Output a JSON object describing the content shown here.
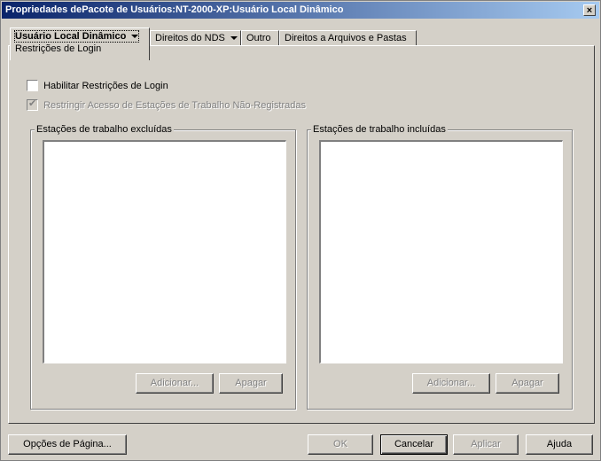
{
  "window": {
    "title": "Propriedades dePacote de Usuários:NT-2000-XP:Usuário Local Dinâmico",
    "close_glyph": "×"
  },
  "tabs": {
    "active": {
      "label": "Usuário Local Dinâmico",
      "sublabel": "Restrições de Login"
    },
    "nds": {
      "label": "Direitos do NDS"
    },
    "outro": {
      "label": "Outro"
    },
    "files": {
      "label": "Direitos a Arquivos e Pastas"
    }
  },
  "options": {
    "enable_login_restrictions": {
      "label": "Habilitar Restrições de Login",
      "checked": false
    },
    "restrict_unregistered": {
      "label": "Restringir Acesso de Estações de Trabalho Não-Registradas",
      "checked": true,
      "enabled": false
    }
  },
  "excluded_group": {
    "title": "Estações de trabalho excluídas",
    "items": [],
    "add_label": "Adicionar...",
    "delete_label": "Apagar"
  },
  "included_group": {
    "title": "Estações de trabalho incluídas",
    "items": [],
    "add_label": "Adicionar...",
    "delete_label": "Apagar"
  },
  "footer": {
    "page_options_label": "Opções de Página...",
    "ok_label": "OK",
    "cancel_label": "Cancelar",
    "apply_label": "Aplicar",
    "help_label": "Ajuda"
  },
  "colors": {
    "face": "#d4d0c8",
    "title_start": "#0a246a",
    "title_end": "#a6caf0"
  }
}
